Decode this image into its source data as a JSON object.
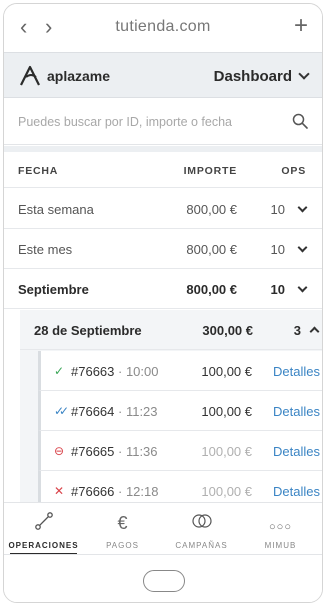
{
  "browser": {
    "url": "tutienda.com",
    "back_icon": "‹",
    "forward_icon": "›",
    "new_tab_icon": "+"
  },
  "header": {
    "brand": "aplazame",
    "section": "Dashboard"
  },
  "search": {
    "placeholder": "Puedes buscar por ID, importe o fecha",
    "value": ""
  },
  "table": {
    "columns": {
      "date": "FECHA",
      "amount": "IMPORTE",
      "ops": "OPS"
    },
    "rows": [
      {
        "label": "Esta semana",
        "amount": "800,00 €",
        "ops": "10"
      },
      {
        "label": "Este mes",
        "amount": "800,00 €",
        "ops": "10"
      },
      {
        "label": "Septiembre",
        "amount": "800,00 €",
        "ops": "10"
      }
    ],
    "day": {
      "label": "28 de Septiembre",
      "amount": "300,00 €",
      "ops": "3"
    },
    "operations": [
      {
        "id": "#76663",
        "time": "10:00",
        "amount": "100,00 €",
        "action": "Detalles",
        "status": "✓",
        "status_color": "#3aa657"
      },
      {
        "id": "#76664",
        "time": "11:23",
        "amount": "100,00 €",
        "action": "Detalles",
        "status": "✓✓",
        "status_color": "#3a84c4"
      },
      {
        "id": "#76665",
        "time": "11:36",
        "amount": "100,00 €",
        "action": "Detalles",
        "status": "⊖",
        "status_color": "#d9434a"
      },
      {
        "id": "#76666",
        "time": "12:18",
        "amount": "100,00 €",
        "action": "Detalles",
        "status": "✕",
        "status_color": "#d9434a"
      }
    ]
  },
  "tabs": [
    {
      "label": "OPERACIONES",
      "icon": "⟋"
    },
    {
      "label": "PAGOS",
      "icon": "€"
    },
    {
      "label": "CAMPAÑAS",
      "icon": "◯"
    },
    {
      "label": "MIMUB",
      "icon": "○○○"
    }
  ]
}
